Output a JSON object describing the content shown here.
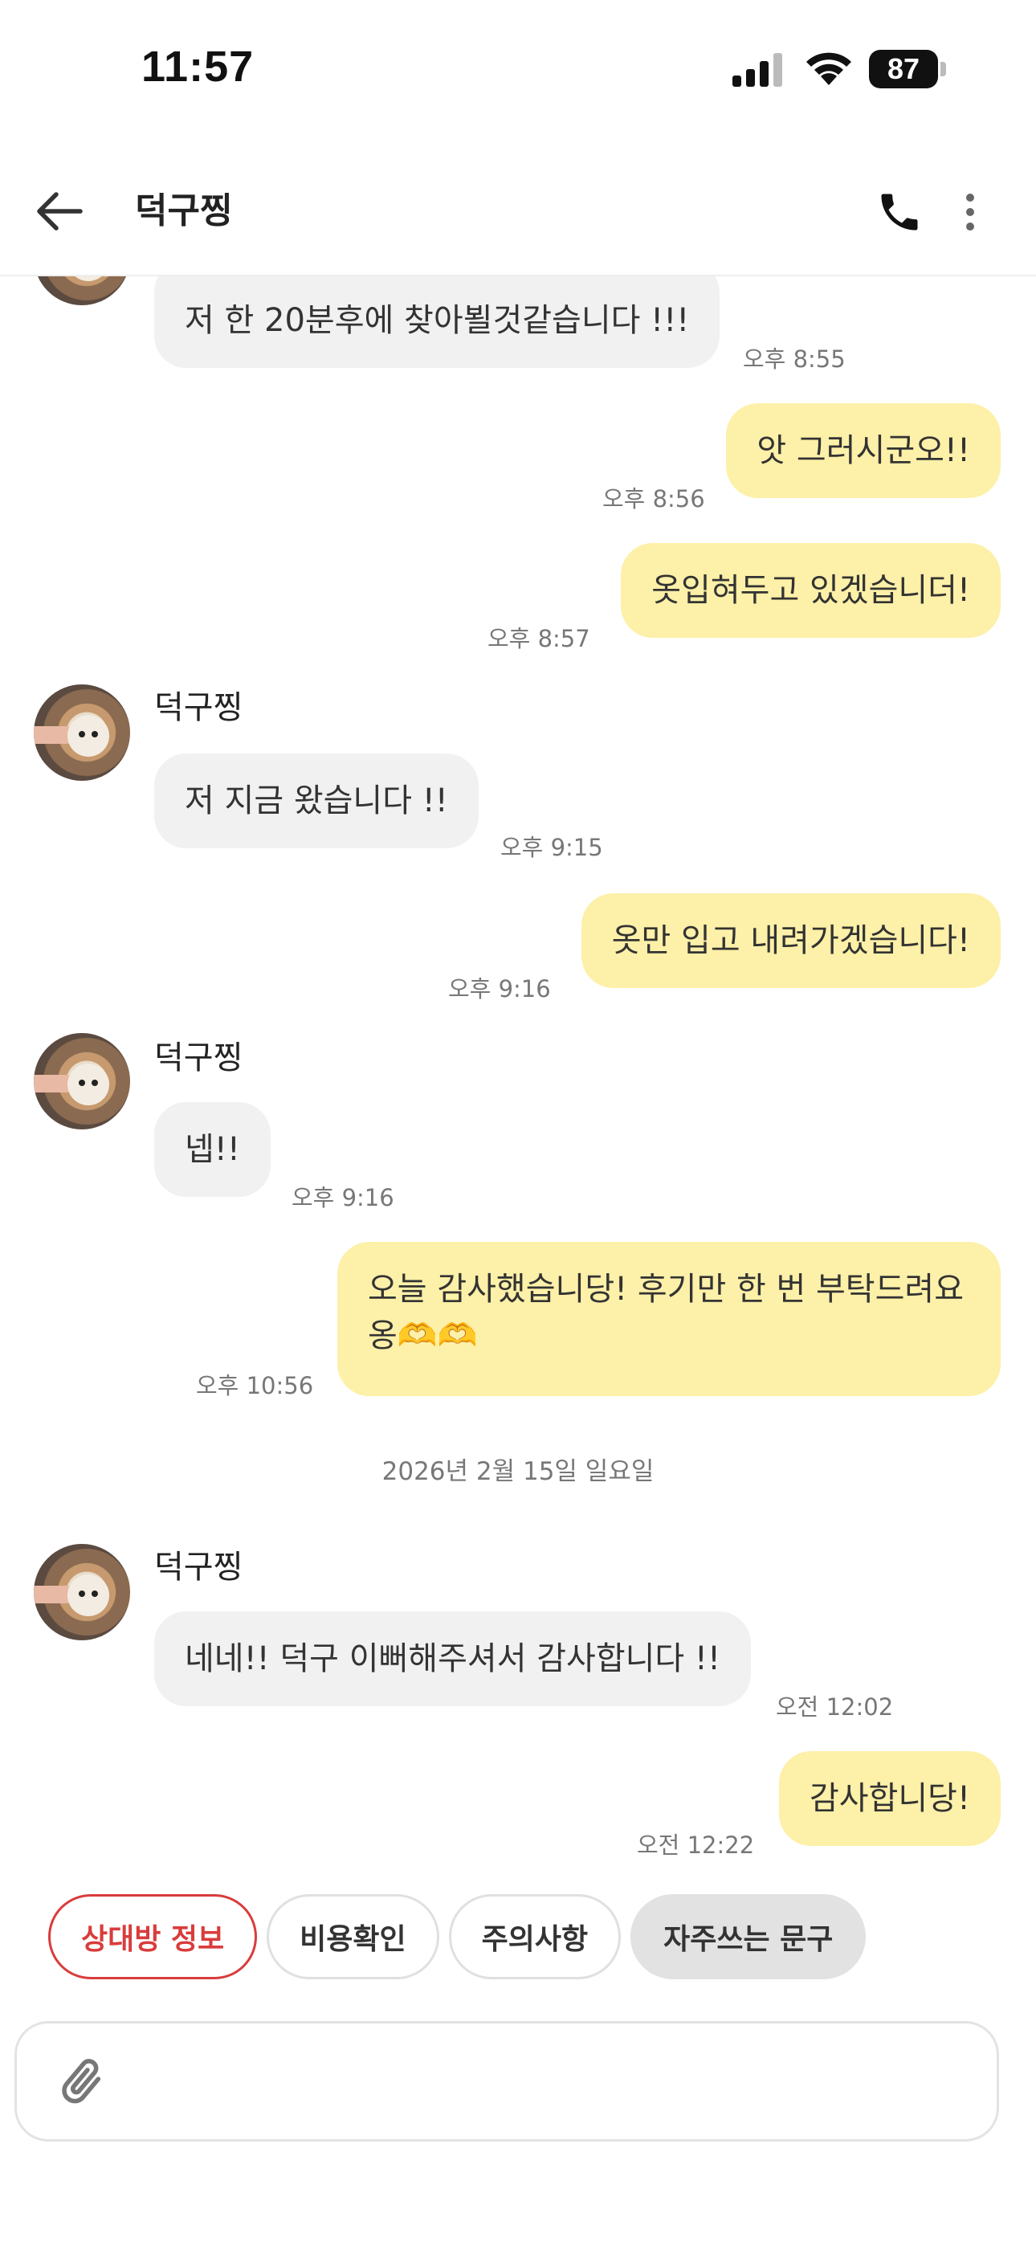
{
  "status_bar": {
    "time": "11:57",
    "battery": "87"
  },
  "header": {
    "title": "덕구찡"
  },
  "messages": [
    {
      "text": "저 한 20분후에 찾아뵐것같습니다 !!!",
      "time": "오후 8:55"
    },
    {
      "text": "앗 그러시군오!!",
      "time": "오후 8:56"
    },
    {
      "text": "옷입혀두고 있겠습니더!",
      "time": "오후 8:57"
    },
    {
      "sender": "덕구찡",
      "text": "저 지금 왔습니다 !!",
      "time": "오후 9:15"
    },
    {
      "text": "옷만 입고 내려가겠습니다!",
      "time": "오후 9:16"
    },
    {
      "sender": "덕구찡",
      "text": "넵!!",
      "time": "오후 9:16"
    },
    {
      "text": "오늘 감사했습니당! 후기만 한 번 부탁드려요옹🫶🫶",
      "time": "오후 10:56"
    },
    {
      "sender": "덕구찡",
      "text": "네네!! 덕구 이뻐해주셔서 감사합니다 !!",
      "time": "오전 12:02"
    },
    {
      "text": "감사합니당!",
      "time": "오전 12:22"
    }
  ],
  "date_divider": "2026년 2월 15일 일요일",
  "chips": [
    "상대방 정보",
    "비용확인",
    "주의사항",
    "자주쓰는 문구"
  ],
  "input": {
    "placeholder": ""
  },
  "colors": {
    "outgoing_bubble": "#fdf0a8",
    "incoming_bubble": "#f1f1f2",
    "accent_red": "#d93c3c"
  }
}
